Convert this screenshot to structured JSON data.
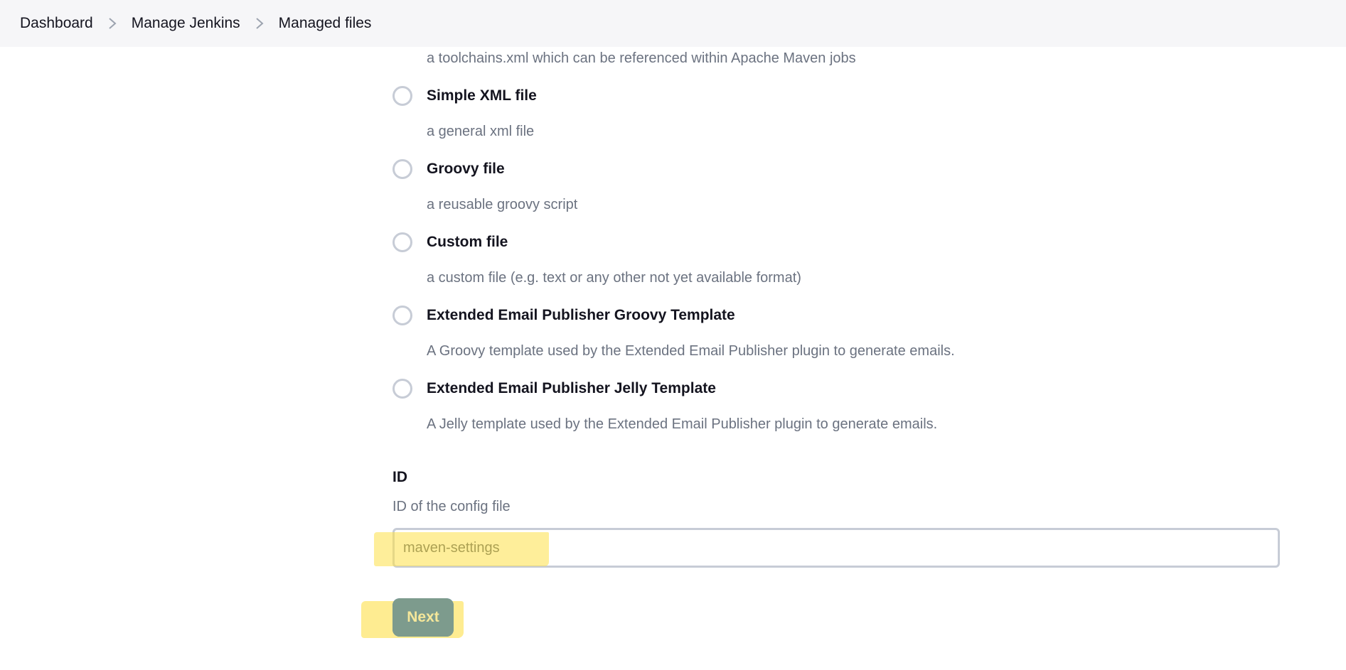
{
  "breadcrumb": {
    "items": [
      "Dashboard",
      "Manage Jenkins",
      "Managed files"
    ]
  },
  "file_types": {
    "partial_description": "a toolchains.xml which can be referenced within Apache Maven jobs",
    "options": [
      {
        "label": "Simple XML file",
        "description": "a general xml file"
      },
      {
        "label": "Groovy file",
        "description": "a reusable groovy script"
      },
      {
        "label": "Custom file",
        "description": "a custom file (e.g. text or any other not yet available format)"
      },
      {
        "label": "Extended Email Publisher Groovy Template",
        "description": "A Groovy template used by the Extended Email Publisher plugin to generate emails."
      },
      {
        "label": "Extended Email Publisher Jelly Template",
        "description": "A Jelly template used by the Extended Email Publisher plugin to generate emails."
      }
    ]
  },
  "id_field": {
    "label": "ID",
    "description": "ID of the config file",
    "value": "maven-settings"
  },
  "next_button": {
    "label": "Next"
  },
  "colors": {
    "primary_button": "#1f6feb",
    "highlight": "#fde047"
  }
}
